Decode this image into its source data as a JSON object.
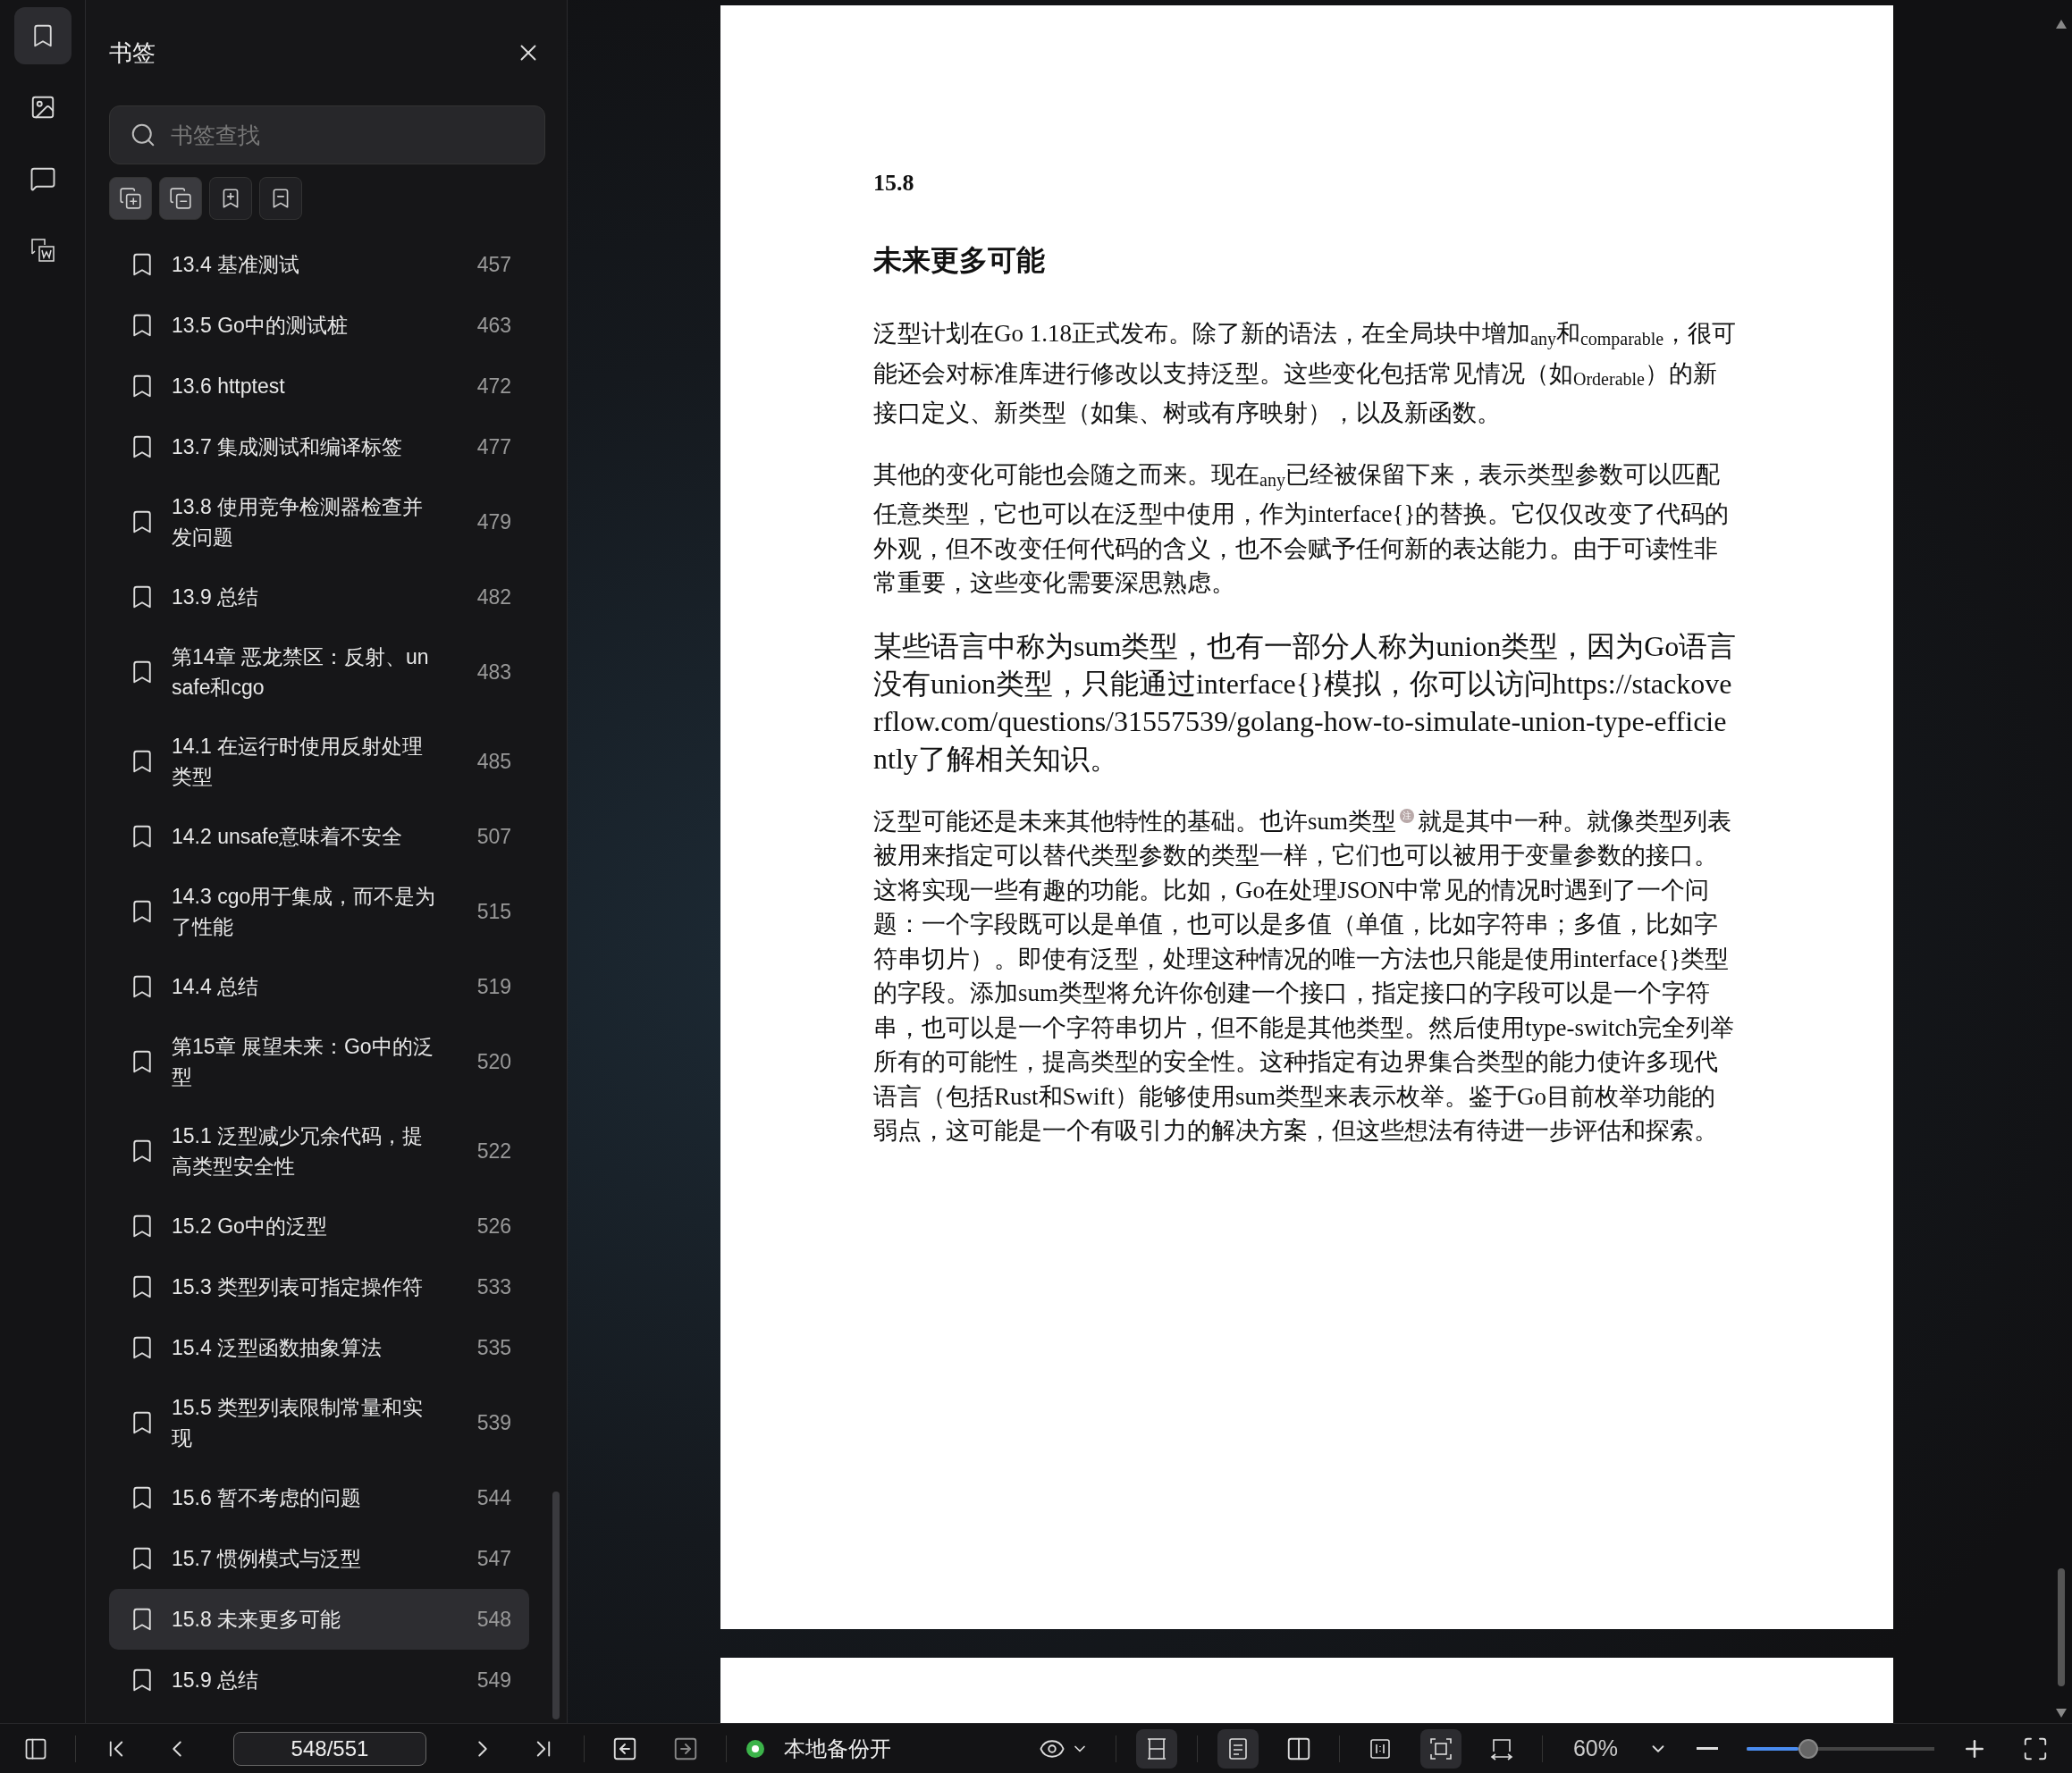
{
  "rail": [
    {
      "kind": "bookmarks",
      "selected": true
    },
    {
      "kind": "thumbnails",
      "selected": false
    },
    {
      "kind": "comments",
      "selected": false
    },
    {
      "kind": "convert",
      "selected": false
    }
  ],
  "sidebar": {
    "title": "书签",
    "search": {
      "placeholder": "书签查找"
    },
    "tools": [
      {
        "kind": "expand",
        "on": true
      },
      {
        "kind": "collapse",
        "on": true
      },
      {
        "kind": "add",
        "on": false
      },
      {
        "kind": "remove",
        "on": false
      }
    ],
    "items": [
      {
        "label": "13.4 基准测试",
        "page": "457",
        "selected": false
      },
      {
        "label": "13.5 Go中的测试桩",
        "page": "463",
        "selected": false
      },
      {
        "label": "13.6 httptest",
        "page": "472",
        "selected": false
      },
      {
        "label": "13.7 集成测试和编译标签",
        "page": "477",
        "selected": false
      },
      {
        "label": "13.8 使用竞争检测器检查并发问题",
        "page": "479",
        "selected": false
      },
      {
        "label": "13.9 总结",
        "page": "482",
        "selected": false
      },
      {
        "label": "第14章 恶龙禁区：反射、unsafe和cgo",
        "page": "483",
        "selected": false
      },
      {
        "label": "14.1 在运行时使用反射处理类型",
        "page": "485",
        "selected": false
      },
      {
        "label": "14.2 unsafe意味着不安全",
        "page": "507",
        "selected": false
      },
      {
        "label": "14.3 cgo用于集成，而不是为了性能",
        "page": "515",
        "selected": false
      },
      {
        "label": "14.4 总结",
        "page": "519",
        "selected": false
      },
      {
        "label": "第15章 展望未来：Go中的泛型",
        "page": "520",
        "selected": false
      },
      {
        "label": "15.1 泛型减少冗余代码，提高类型安全性",
        "page": "522",
        "selected": false
      },
      {
        "label": "15.2 Go中的泛型",
        "page": "526",
        "selected": false
      },
      {
        "label": "15.3 类型列表可指定操作符",
        "page": "533",
        "selected": false
      },
      {
        "label": "15.4 泛型函数抽象算法",
        "page": "535",
        "selected": false
      },
      {
        "label": "15.5 类型列表限制常量和实现",
        "page": "539",
        "selected": false
      },
      {
        "label": "15.6 暂不考虑的问题",
        "page": "544",
        "selected": false
      },
      {
        "label": "15.7 惯例模式与泛型",
        "page": "547",
        "selected": false
      },
      {
        "label": "15.8 未来更多可能",
        "page": "548",
        "selected": true
      },
      {
        "label": "15.9 总结",
        "page": "549",
        "selected": false
      }
    ]
  },
  "document": {
    "section_number": "15.8",
    "heading": "未来更多可能",
    "paragraphs": [
      {
        "kind": "body",
        "text": "泛型计划在Go 1.18正式发布。除了新的语法，在全局块中增加$_{any}$和$_{comparable}$，很可能还会对标准库进行修改以支持泛型。这些变化包括常见情况（如$_{Orderable}$）的新接口定义、新类型（如集、树或有序映射），以及新函数。"
      },
      {
        "kind": "body",
        "text": "其他的变化可能也会随之而来。现在$_{any}$已经被保留下来，表示类型参数可以匹配任意类型，它也可以在泛型中使用，作为interface{}的替换。它仅仅改变了代码的外观，但不改变任何代码的含义，也不会赋予任何新的表达能力。由于可读性非常重要，这些变化需要深思熟虑。"
      },
      {
        "kind": "note",
        "text": "某些语言中称为sum类型，也有一部分人称为union类型，因为Go语言没有union类型，只能通过interface{}模拟，你可以访问https://stackoverflow.com/questions/31557539/golang-how-to-simulate-union-type-efficiently了解相关知识。"
      },
      {
        "kind": "body",
        "text": "泛型可能还是未来其他特性的基础。也许sum类型$^{注}$就是其中一种。就像类型列表被用来指定可以替代类型参数的类型一样，它们也可以被用于变量参数的接口。这将实现一些有趣的功能。比如，Go在处理JSON中常见的情况时遇到了一个问题：一个字段既可以是单值，也可以是多值（单值，比如字符串；多值，比如字符串切片）。即使有泛型，处理这种情况的唯一方法也只能是使用interface{}类型的字段。添加sum类型将允许你创建一个接口，指定接口的字段可以是一个字符串，也可以是一个字符串切片，但不能是其他类型。然后使用type-switch完全列举所有的可能性，提高类型的安全性。这种指定有边界集合类型的能力使许多现代语言（包括Rust和Swift）能够使用sum类型来表示枚举。鉴于Go目前枚举功能的弱点，这可能是一个有吸引力的解决方案，但这些想法有待进一步评估和探索。"
      }
    ]
  },
  "status_bar": {
    "page_field": "548/551",
    "backup": {
      "label": "本地备份开",
      "on": true
    },
    "view_buttons": [
      {
        "kind": "continuous",
        "on": true
      },
      {
        "kind": "single",
        "on": true
      },
      {
        "kind": "double",
        "on": false
      },
      {
        "kind": "split",
        "on": false
      },
      {
        "kind": "fit-page",
        "on": true
      },
      {
        "kind": "fit-width",
        "on": false
      }
    ],
    "zoom": {
      "label": "60%",
      "level": 0.33
    }
  }
}
